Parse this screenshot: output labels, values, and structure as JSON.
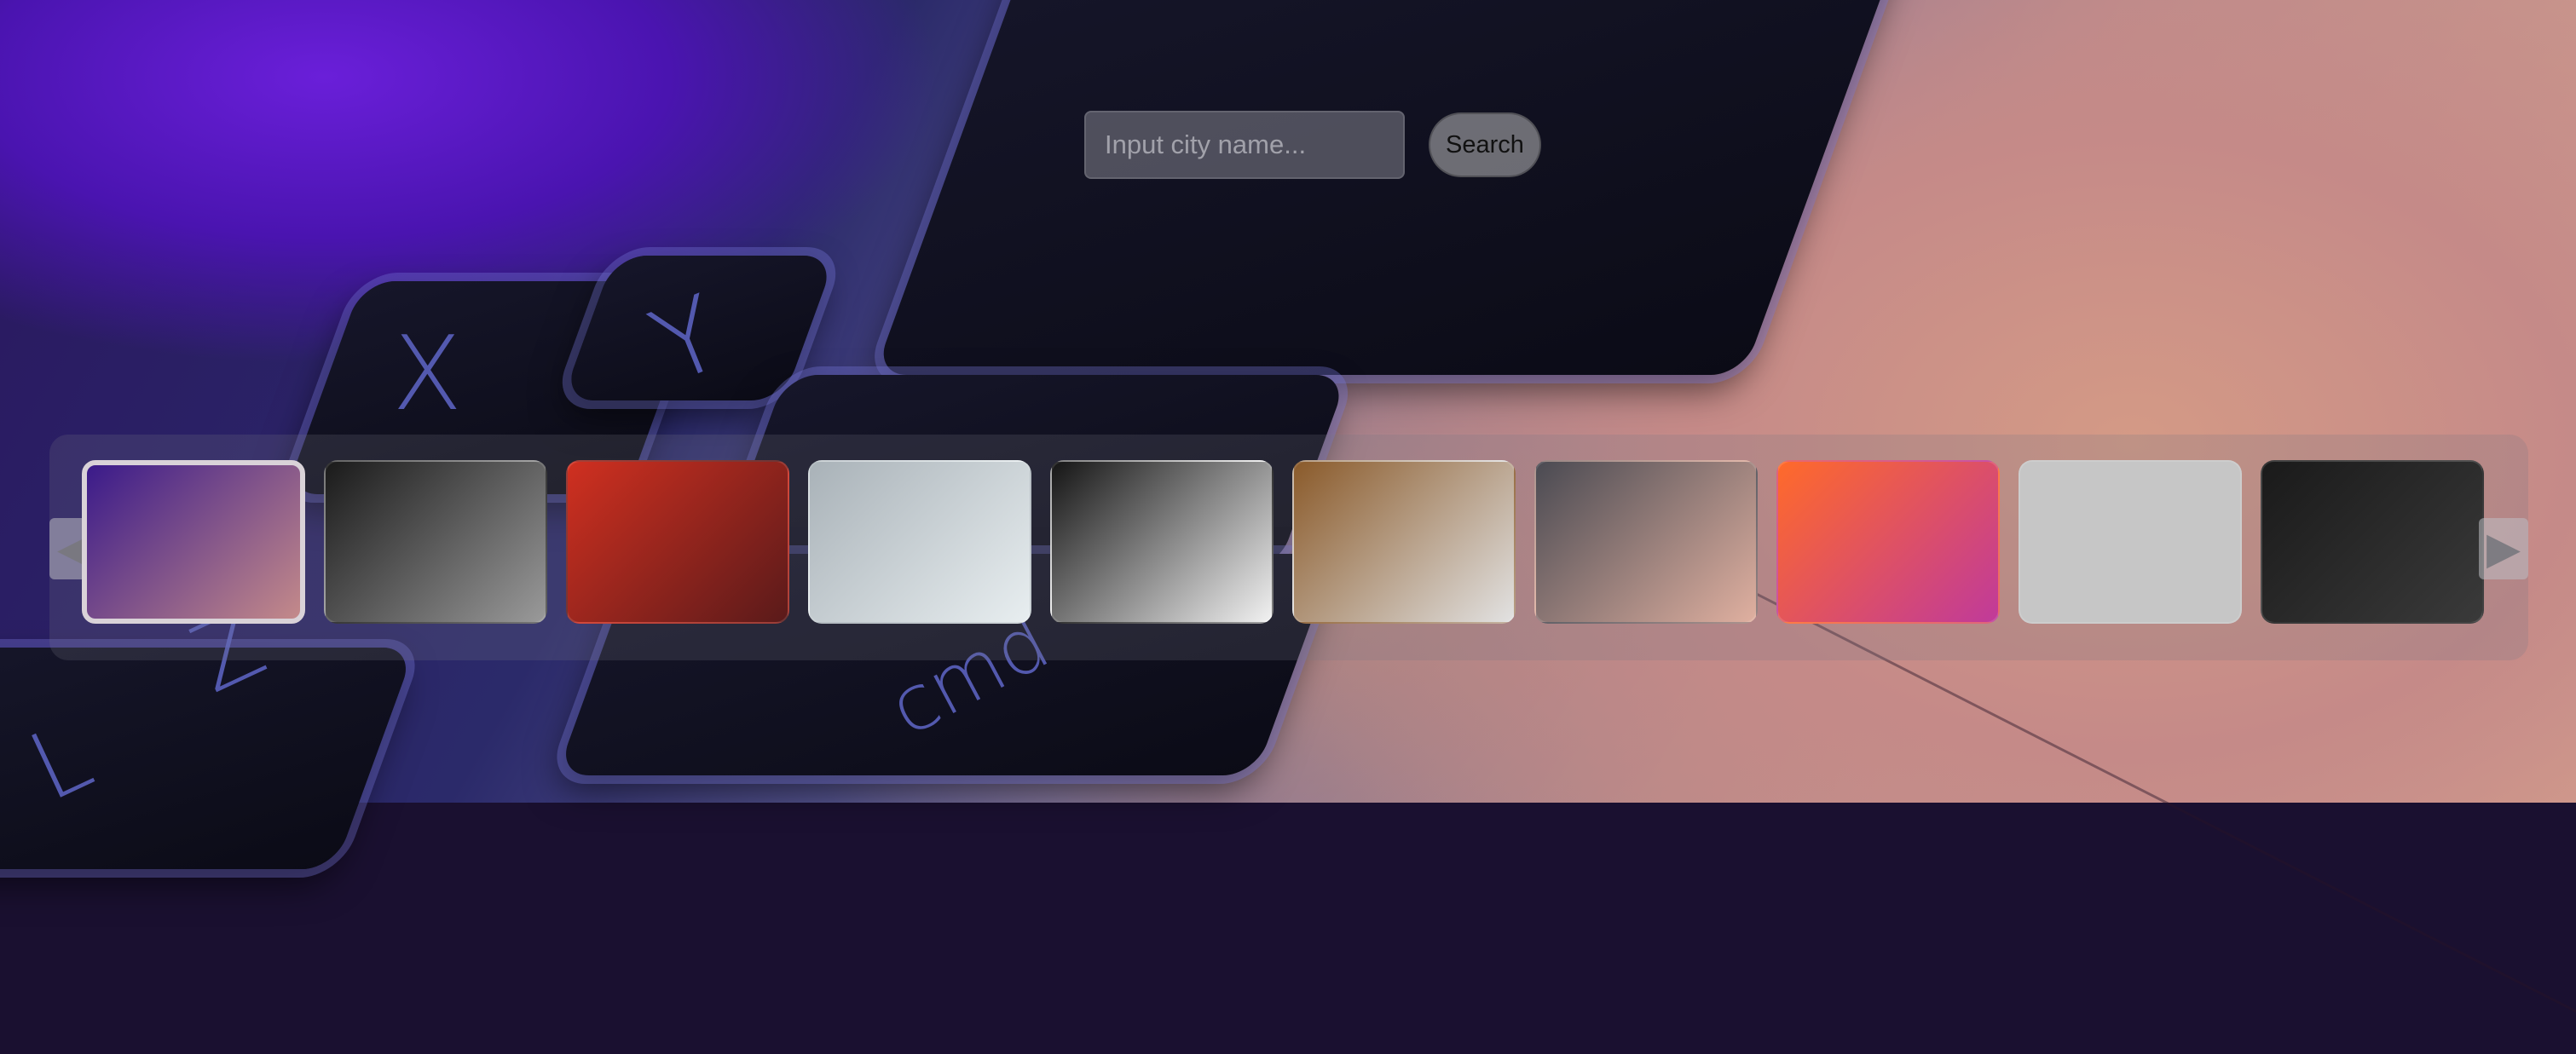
{
  "search": {
    "placeholder": "Input city name...",
    "button_label": "Search"
  },
  "background": {
    "key_labels": [
      "X",
      "Y",
      "cmd",
      "L",
      "Z"
    ],
    "colors": {
      "purple": "#5a16c8",
      "peach": "#d49a86",
      "key": "#10101e"
    }
  },
  "carousel": {
    "prev_glyph": "◀",
    "next_glyph": "▶",
    "selected_index": 0,
    "thumbnails": [
      {
        "name": "keyboard-purple-peach",
        "colors": [
          "#3a1a8a",
          "#c48a8a"
        ]
      },
      {
        "name": "hand-black-white",
        "colors": [
          "#1a1a1a",
          "#9a9a9a"
        ]
      },
      {
        "name": "red-laptop-keyboard",
        "colors": [
          "#d03020",
          "#5a1a1a"
        ]
      },
      {
        "name": "silver-apple-logo",
        "colors": [
          "#a9b2b8",
          "#e8eef0"
        ]
      },
      {
        "name": "white-keyboard-corner",
        "colors": [
          "#151515",
          "#f2f2f2"
        ]
      },
      {
        "name": "wood-newspaper",
        "colors": [
          "#8a5a2a",
          "#e2e2e2"
        ]
      },
      {
        "name": "hand-on-macbook",
        "colors": [
          "#4a4a52",
          "#e0b0a0"
        ]
      },
      {
        "name": "colorful-ipad-screen",
        "colors": [
          "#ff6a2a",
          "#c03a9a"
        ]
      },
      {
        "name": "blank-gray",
        "colors": [
          "#c6c6c6",
          "#c6c6c6"
        ]
      },
      {
        "name": "dark-keyboard-grid",
        "colors": [
          "#1a1a1a",
          "#3a3a3a"
        ]
      }
    ]
  }
}
